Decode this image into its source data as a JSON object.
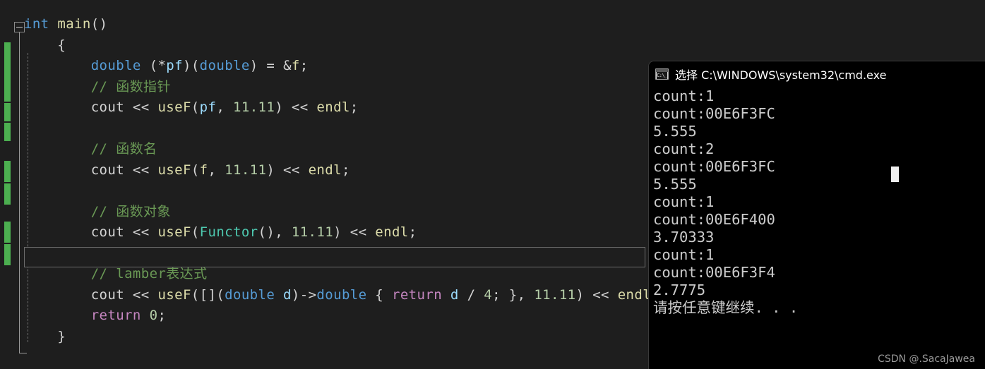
{
  "editor": {
    "name": "visual-studio-code-editor",
    "background": "#1e1e1e",
    "change_bar_color": "#4caf50",
    "lines": [
      {
        "indent": 0,
        "tokens": [
          {
            "t": "int",
            "c": "kw"
          },
          {
            "t": " ",
            "c": "pn"
          },
          {
            "t": "main",
            "c": "fn"
          },
          {
            "t": "()",
            "c": "pn"
          }
        ]
      },
      {
        "indent": 1,
        "tokens": [
          {
            "t": "{",
            "c": "pn"
          }
        ]
      },
      {
        "indent": 2,
        "tokens": [
          {
            "t": "double",
            "c": "kw"
          },
          {
            "t": " (*",
            "c": "pn"
          },
          {
            "t": "pf",
            "c": "var"
          },
          {
            "t": ")(",
            "c": "pn"
          },
          {
            "t": "double",
            "c": "kw"
          },
          {
            "t": ") = &",
            "c": "pn"
          },
          {
            "t": "f",
            "c": "fn"
          },
          {
            "t": ";",
            "c": "pn"
          }
        ]
      },
      {
        "indent": 2,
        "tokens": [
          {
            "t": "// 函数指针",
            "c": "cmt"
          }
        ]
      },
      {
        "indent": 2,
        "tokens": [
          {
            "t": "cout",
            "c": "pn"
          },
          {
            "t": " << ",
            "c": "pn"
          },
          {
            "t": "useF",
            "c": "fn"
          },
          {
            "t": "(",
            "c": "pn"
          },
          {
            "t": "pf",
            "c": "var"
          },
          {
            "t": ", ",
            "c": "pn"
          },
          {
            "t": "11.11",
            "c": "num"
          },
          {
            "t": ") << ",
            "c": "pn"
          },
          {
            "t": "endl",
            "c": "fn"
          },
          {
            "t": ";",
            "c": "pn"
          }
        ]
      },
      {
        "indent": 2,
        "tokens": []
      },
      {
        "indent": 2,
        "tokens": [
          {
            "t": "// 函数名",
            "c": "cmt"
          }
        ]
      },
      {
        "indent": 2,
        "tokens": [
          {
            "t": "cout",
            "c": "pn"
          },
          {
            "t": " << ",
            "c": "pn"
          },
          {
            "t": "useF",
            "c": "fn"
          },
          {
            "t": "(",
            "c": "pn"
          },
          {
            "t": "f",
            "c": "fn"
          },
          {
            "t": ", ",
            "c": "pn"
          },
          {
            "t": "11.11",
            "c": "num"
          },
          {
            "t": ") << ",
            "c": "pn"
          },
          {
            "t": "endl",
            "c": "fn"
          },
          {
            "t": ";",
            "c": "pn"
          }
        ]
      },
      {
        "indent": 2,
        "tokens": []
      },
      {
        "indent": 2,
        "tokens": [
          {
            "t": "// 函数对象",
            "c": "cmt"
          }
        ]
      },
      {
        "indent": 2,
        "tokens": [
          {
            "t": "cout",
            "c": "pn"
          },
          {
            "t": " << ",
            "c": "pn"
          },
          {
            "t": "useF",
            "c": "fn"
          },
          {
            "t": "(",
            "c": "pn"
          },
          {
            "t": "Functor",
            "c": "type"
          },
          {
            "t": "(), ",
            "c": "pn"
          },
          {
            "t": "11.11",
            "c": "num"
          },
          {
            "t": ") << ",
            "c": "pn"
          },
          {
            "t": "endl",
            "c": "fn"
          },
          {
            "t": ";",
            "c": "pn"
          }
        ]
      },
      {
        "indent": 2,
        "tokens": []
      },
      {
        "indent": 2,
        "tokens": [
          {
            "t": "// lamber表达式",
            "c": "cmt"
          }
        ]
      },
      {
        "indent": 2,
        "tokens": [
          {
            "t": "cout",
            "c": "pn"
          },
          {
            "t": " << ",
            "c": "pn"
          },
          {
            "t": "useF",
            "c": "fn"
          },
          {
            "t": "([](",
            "c": "pn"
          },
          {
            "t": "double",
            "c": "kw"
          },
          {
            "t": " ",
            "c": "pn"
          },
          {
            "t": "d",
            "c": "var"
          },
          {
            "t": ")->",
            "c": "pn"
          },
          {
            "t": "double",
            "c": "kw"
          },
          {
            "t": " { ",
            "c": "pn"
          },
          {
            "t": "return",
            "c": "ctl"
          },
          {
            "t": " ",
            "c": "pn"
          },
          {
            "t": "d",
            "c": "var"
          },
          {
            "t": " / ",
            "c": "pn"
          },
          {
            "t": "4",
            "c": "num"
          },
          {
            "t": "; }, ",
            "c": "pn"
          },
          {
            "t": "11.11",
            "c": "num"
          },
          {
            "t": ") << ",
            "c": "pn"
          },
          {
            "t": "endl",
            "c": "fn"
          },
          {
            "t": ";",
            "c": "pn"
          }
        ]
      },
      {
        "indent": 2,
        "tokens": [
          {
            "t": "return",
            "c": "ctl"
          },
          {
            "t": " ",
            "c": "pn"
          },
          {
            "t": "0",
            "c": "num"
          },
          {
            "t": ";",
            "c": "pn"
          }
        ]
      },
      {
        "indent": 1,
        "tokens": [
          {
            "t": "}",
            "c": "pn"
          }
        ]
      }
    ]
  },
  "console": {
    "window_title": "选择 C:\\WINDOWS\\system32\\cmd.exe",
    "icon_label": "C:\\_",
    "background": "#000000",
    "text_color": "#cccccc",
    "output_lines": [
      "count:1",
      "count:00E6F3FC",
      "5.555",
      "count:2",
      "count:00E6F3FC",
      "5.555",
      "count:1",
      "count:00E6F400",
      "3.70333",
      "count:1",
      "count:00E6F3F4",
      "2.7775",
      "请按任意键继续. . ."
    ]
  },
  "watermark": {
    "text": "CSDN @.SacaJawea"
  }
}
